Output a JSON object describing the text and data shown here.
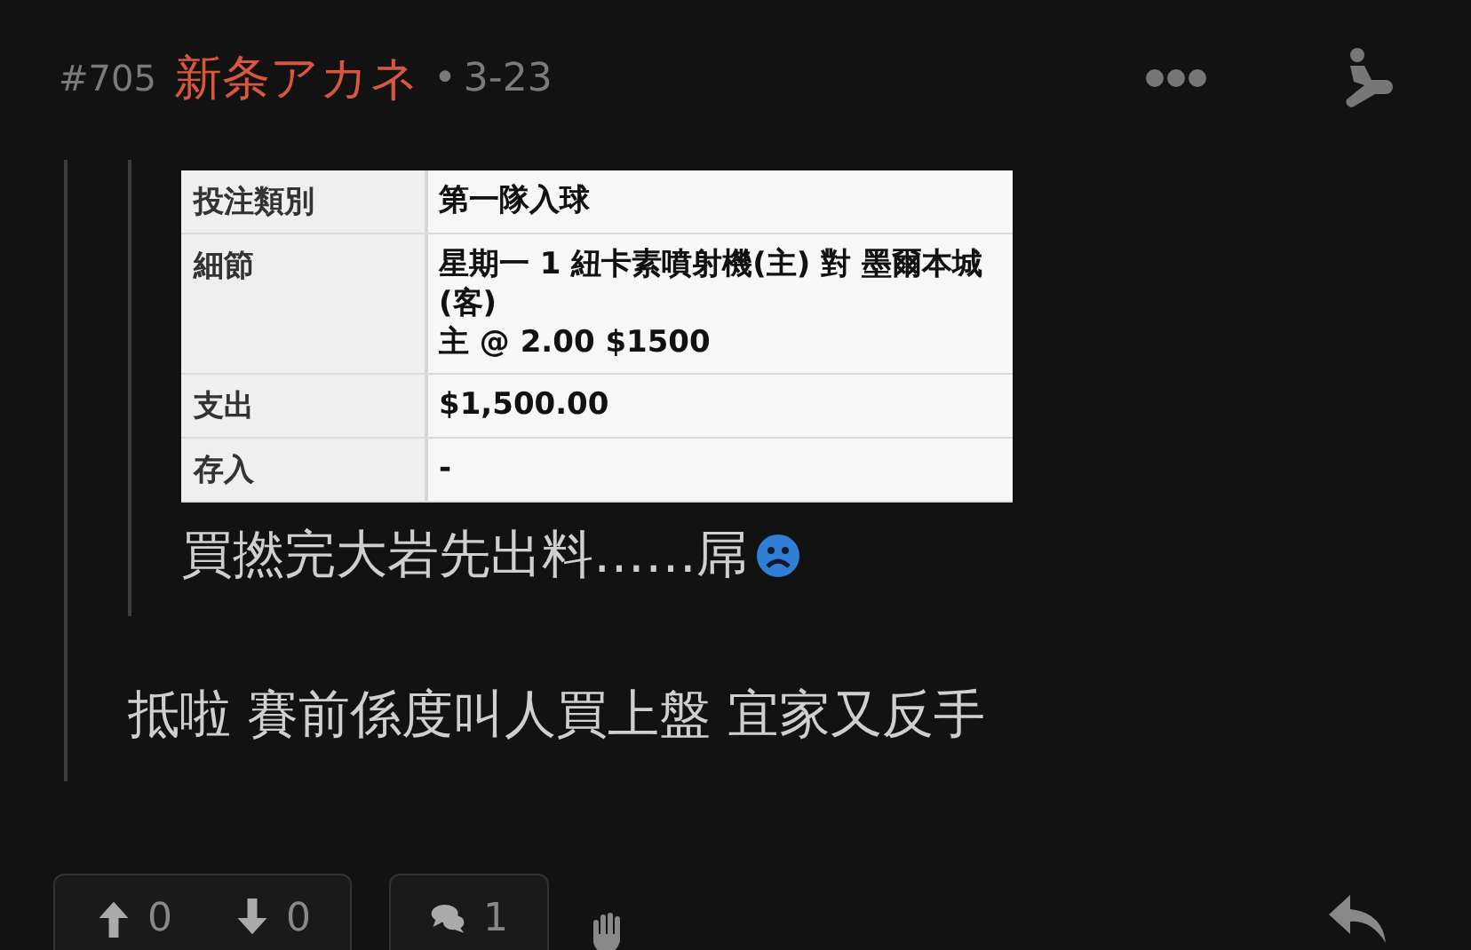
{
  "post": {
    "number": "#705",
    "author": "新条アカネ",
    "separator": "•",
    "date": "3-23"
  },
  "quote": {
    "nested_quote": {
      "table": {
        "rows": [
          {
            "label": "投注類別",
            "lines": [
              "第一隊入球"
            ]
          },
          {
            "label": "細節",
            "lines": [
              "星期一 1  紐卡素噴射機(主) 對 墨爾本城(客)",
              "主 @ 2.00 $1500"
            ]
          },
          {
            "label": "支出",
            "lines": [
              "$1,500.00"
            ]
          },
          {
            "label": "存入",
            "lines": [
              "-"
            ]
          }
        ]
      },
      "text": "買撚完大岩先出料……屌"
    },
    "text": "抵啦 賽前係度叫人買上盤 宜家又反手"
  },
  "footer": {
    "upvotes": "0",
    "downvotes": "0",
    "comments": "1"
  }
}
